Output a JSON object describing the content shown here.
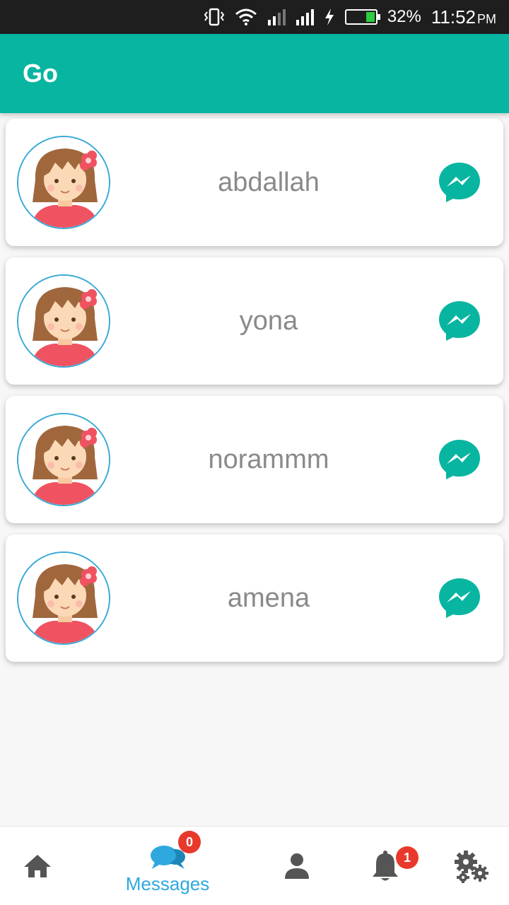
{
  "status_bar": {
    "battery_percent": "32%",
    "time": "11:52",
    "ampm": "PM",
    "icons": [
      "vibrate-icon",
      "wifi-icon",
      "signal-icon",
      "signal-icon",
      "charging-icon",
      "battery-icon"
    ]
  },
  "app_bar": {
    "title": "Go"
  },
  "contacts": [
    {
      "name": "abdallah",
      "avatar": "girl-avatar",
      "action_icon": "messenger-icon"
    },
    {
      "name": "yona",
      "avatar": "girl-avatar",
      "action_icon": "messenger-icon"
    },
    {
      "name": "norammm",
      "avatar": "girl-avatar",
      "action_icon": "messenger-icon"
    },
    {
      "name": "amena",
      "avatar": "girl-avatar",
      "action_icon": "messenger-icon"
    }
  ],
  "bottom_nav": {
    "home": {
      "icon": "home-icon"
    },
    "messages": {
      "icon": "chat-bubbles-icon",
      "label": "Messages",
      "badge": "0"
    },
    "profile": {
      "icon": "person-icon"
    },
    "notifications": {
      "icon": "bell-icon",
      "badge": "1"
    },
    "settings": {
      "icon": "gears-icon"
    }
  },
  "colors": {
    "primary": "#08b5a0",
    "accent_blue": "#2ea8df",
    "badge_red": "#e8392c",
    "name_gray": "#8a8a8a"
  }
}
